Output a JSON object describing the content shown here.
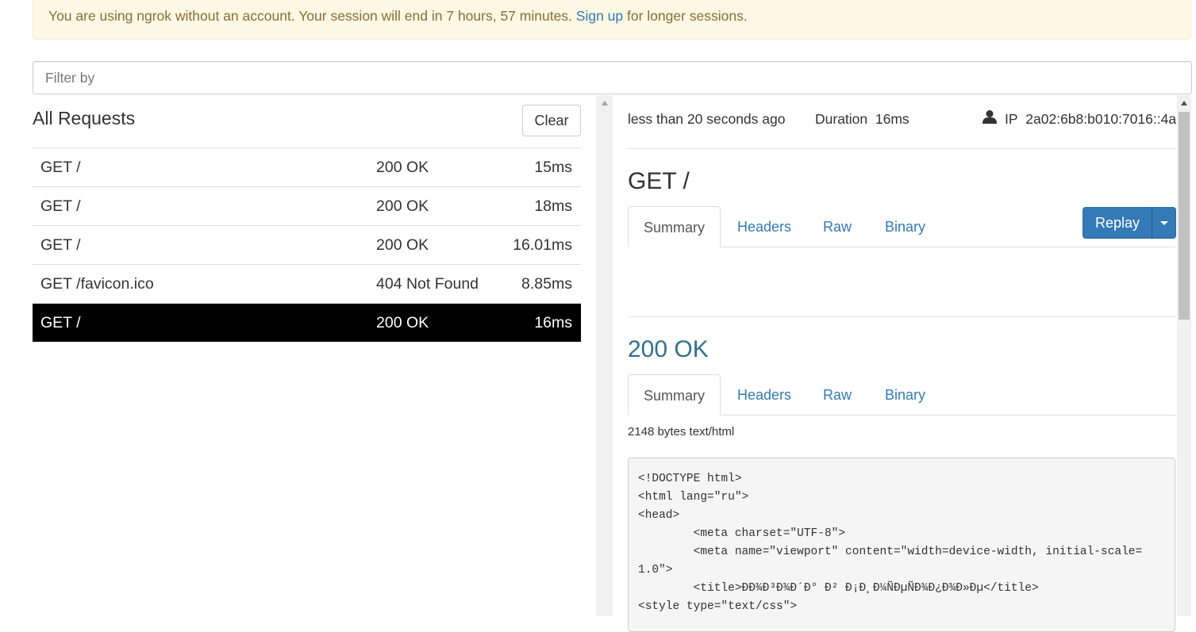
{
  "banner": {
    "text_before": "You are using ngrok without an account. Your session will end in 7 hours, 57 minutes. ",
    "link": "Sign up",
    "text_after": " for longer sessions."
  },
  "filter": {
    "placeholder": "Filter by",
    "value": ""
  },
  "requests_panel": {
    "title": "All Requests",
    "clear_label": "Clear",
    "rows": [
      {
        "request": "GET /",
        "status": "200 OK",
        "duration": "15ms"
      },
      {
        "request": "GET /",
        "status": "200 OK",
        "duration": "18ms"
      },
      {
        "request": "GET /",
        "status": "200 OK",
        "duration": "16.01ms"
      },
      {
        "request": "GET /favicon.ico",
        "status": "404 Not Found",
        "duration": "8.85ms"
      },
      {
        "request": "GET /",
        "status": "200 OK",
        "duration": "16ms",
        "selected": true
      }
    ]
  },
  "detail": {
    "time_ago": "less than 20 seconds ago",
    "duration_label": "Duration",
    "duration_value": "16ms",
    "ip_label": "IP",
    "ip_value": "2a02:6b8:b010:7016::4a",
    "request_line": "GET /",
    "request_tabs": [
      "Summary",
      "Headers",
      "Raw",
      "Binary"
    ],
    "replay_label": "Replay",
    "status_line": "200 OK",
    "response_tabs": [
      "Summary",
      "Headers",
      "Raw",
      "Binary"
    ],
    "body_info": "2148 bytes text/html",
    "code_lines": [
      "<!DOCTYPE html>",
      "<html lang=\"ru\">",
      "<head>",
      "        <meta charset=\"UTF-8\">",
      "        <meta name=\"viewport\" content=\"width=device-width, initial-scale=",
      "1.0\">",
      "        <title>ÐÐ¾Ð³Ð¾Ð´Ð° Ð² Ð¡Ð¸Ð¼ÑÐµÑÐ¾Ð¿Ð¾Ð»Ðµ</title>",
      "<style type=\"text/css\">"
    ]
  },
  "colors": {
    "link": "#337ab7",
    "banner_bg": "#fcf8e3",
    "banner_text": "#8a6d3b",
    "status_ok": "#31708f",
    "selected_row_bg": "#000000"
  }
}
